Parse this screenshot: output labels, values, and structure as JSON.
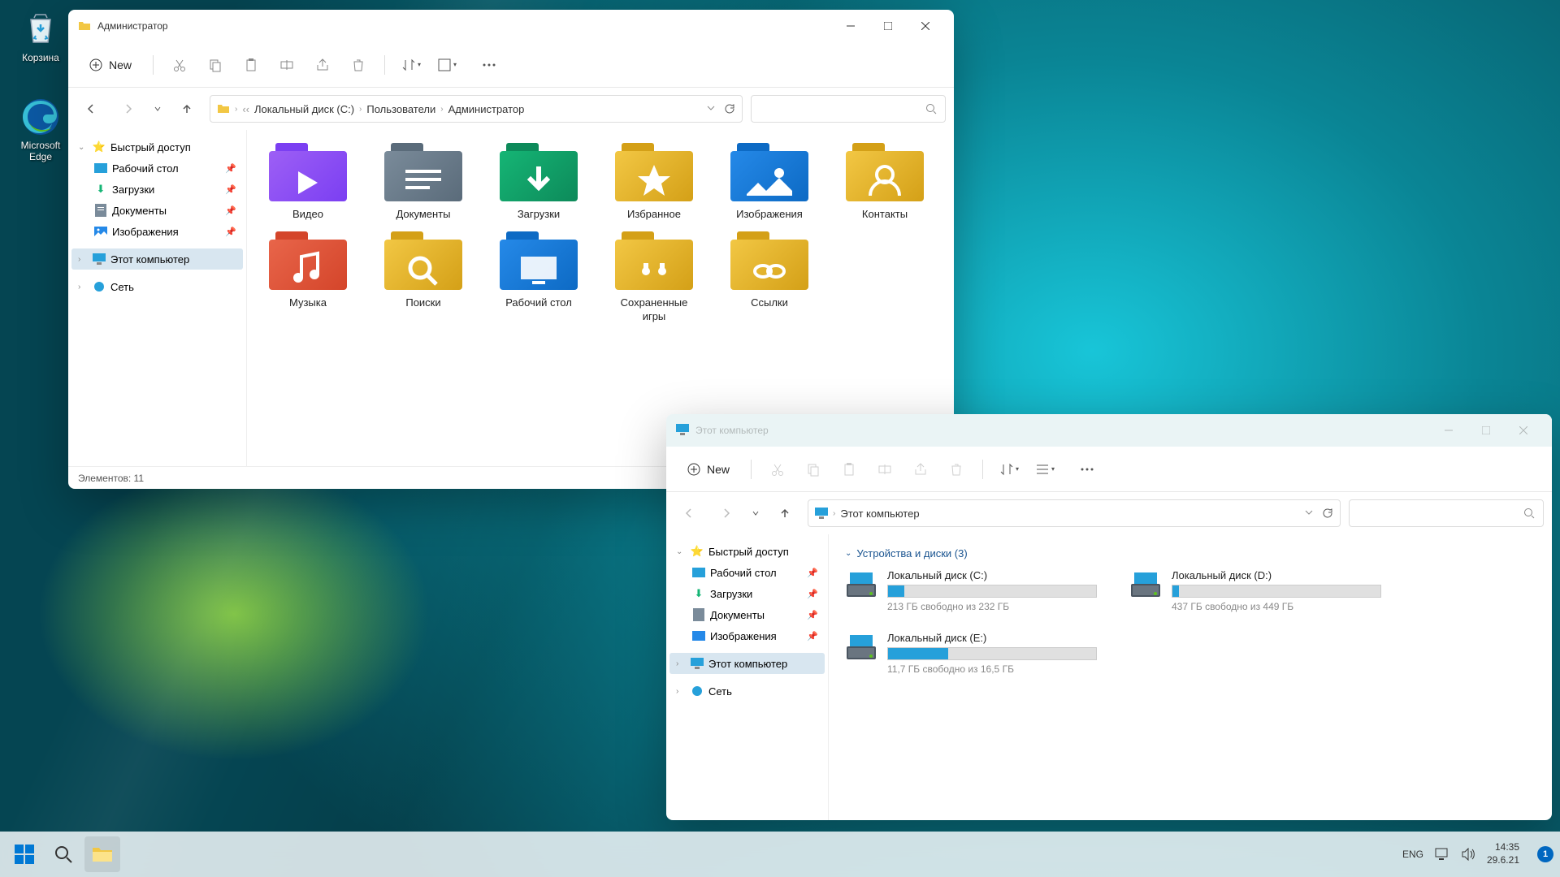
{
  "desktop": {
    "icons": [
      {
        "label": "Корзина"
      },
      {
        "label": "Microsoft Edge"
      }
    ]
  },
  "win1": {
    "title": "Администратор",
    "newLabel": "New",
    "breadcrumb": [
      "Локальный диск (C:)",
      "Пользователи",
      "Администратор"
    ],
    "nav": {
      "quick": "Быстрый доступ",
      "desktop": "Рабочий стол",
      "downloads": "Загрузки",
      "documents": "Документы",
      "pictures": "Изображения",
      "thispc": "Этот компьютер",
      "network": "Сеть"
    },
    "folders": [
      {
        "label": "Видео",
        "bg": "#7b3ff2",
        "fg": "#9d5ff5",
        "icon": "play"
      },
      {
        "label": "Документы",
        "bg": "#5a6b7a",
        "fg": "#7a8b9a",
        "icon": "doc"
      },
      {
        "label": "Загрузки",
        "bg": "#0d8a5a",
        "fg": "#15b575",
        "icon": "down"
      },
      {
        "label": "Избранное",
        "bg": "#d4a017",
        "fg": "#f2c744",
        "icon": "star"
      },
      {
        "label": "Изображения",
        "bg": "#0d6ac4",
        "fg": "#2589e8",
        "icon": "pic"
      },
      {
        "label": "Контакты",
        "bg": "#d4a017",
        "fg": "#f2c744",
        "icon": "user"
      },
      {
        "label": "Музыка",
        "bg": "#d4452a",
        "fg": "#e8654a",
        "icon": "note"
      },
      {
        "label": "Поиски",
        "bg": "#d4a017",
        "fg": "#f2c744",
        "icon": "search"
      },
      {
        "label": "Рабочий стол",
        "bg": "#0d6ac4",
        "fg": "#2589e8",
        "icon": "desk"
      },
      {
        "label": "Сохраненные игры",
        "bg": "#d4a017",
        "fg": "#f2c744",
        "icon": "game"
      },
      {
        "label": "Ссылки",
        "bg": "#d4a017",
        "fg": "#f2c744",
        "icon": "link"
      }
    ],
    "status": "Элементов: 11"
  },
  "win2": {
    "title": "Этот компьютер",
    "newLabel": "New",
    "breadcrumb": [
      "Этот компьютер"
    ],
    "nav": {
      "quick": "Быстрый доступ",
      "desktop": "Рабочий стол",
      "downloads": "Загрузки",
      "documents": "Документы",
      "pictures": "Изображения",
      "thispc": "Этот компьютер",
      "network": "Сеть"
    },
    "sectionHeader": "Устройства и диски (3)",
    "drives": [
      {
        "name": "Локальный диск (C:)",
        "free": "213 ГБ свободно из 232 ГБ",
        "fill": 8
      },
      {
        "name": "Локальный диск (D:)",
        "free": "437 ГБ свободно из 449 ГБ",
        "fill": 3
      },
      {
        "name": "Локальный диск (E:)",
        "free": "11,7 ГБ свободно из 16,5 ГБ",
        "fill": 29
      }
    ]
  },
  "taskbar": {
    "lang": "ENG",
    "time": "14:35",
    "date": "29.6.21"
  }
}
